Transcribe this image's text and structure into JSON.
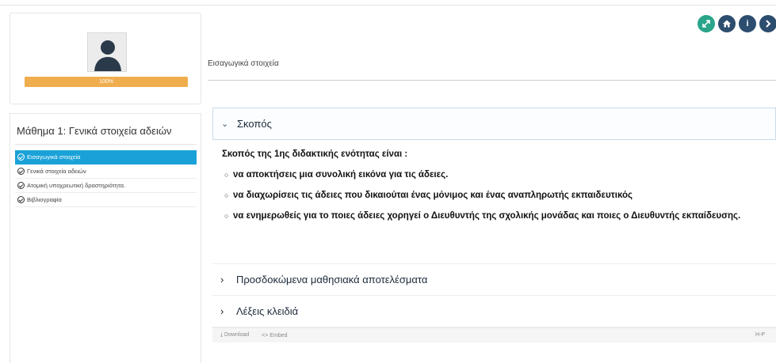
{
  "profile": {
    "progress_percent": 100,
    "progress_label": "100%"
  },
  "lesson": {
    "title": "Μάθημα 1: Γενικά στοιχεία αδειών",
    "items": [
      {
        "label": "Εισαγωγικά στοιχεία",
        "active": true
      },
      {
        "label": "Γενικά στοιχεία αδειών",
        "active": false
      },
      {
        "label": "Ατομική υποχρεωτική δραστηριότητα.",
        "active": false
      },
      {
        "label": "Βιβλιογραφία",
        "active": false
      }
    ]
  },
  "toolbar": {
    "icons": [
      "expand-icon",
      "home-icon",
      "info-icon",
      "next-icon"
    ],
    "info_glyph": "i"
  },
  "content": {
    "heading": "Εισαγωγικά στοιχεία"
  },
  "accordion": {
    "open_section": {
      "title": "Σκοπός",
      "intro": "Σκοπός της 1ης διδακτικής ενότητας είναι :",
      "bullets": [
        "να αποκτήσεις μια συνολική εικόνα για τις άδειες.",
        "να διαχωρίσεις τις άδειες που δικαιούται ένας μόνιμος και ένας αναπληρωτής εκπαιδευτικός",
        "να ενημερωθείς για το ποιες άδειες χορηγεί ο Διευθυντής της σχολικής μονάδας και ποιες ο Διευθυντής εκπαίδευσης."
      ]
    },
    "closed_sections": [
      "Προσδοκώμενα μαθησιακά αποτελέσματα",
      "Λέξεις κλειδιά"
    ]
  },
  "footer": {
    "download_label": "⤓ Download",
    "embed_label": "<> Embed",
    "brand": "H-P"
  },
  "colors": {
    "progress": "#f0ad4e",
    "active_item": "#1aa2d8",
    "toolbar_dark": "#2c4d6e",
    "toolbar_green": "#2aa58a"
  }
}
